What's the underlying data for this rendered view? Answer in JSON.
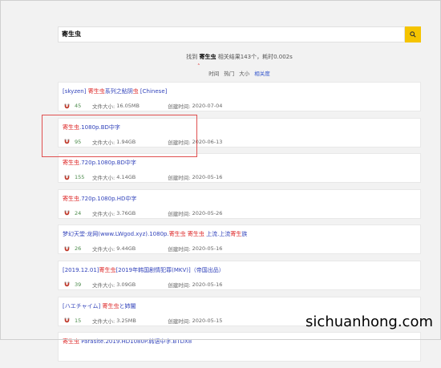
{
  "search": {
    "value": "寄生虫"
  },
  "summary": {
    "prefix": "找到",
    "keyword": "寄生虫",
    "suffix": "相关结果143个，耗时0.002s"
  },
  "sort": {
    "options": [
      "时间",
      "热门",
      "大小",
      "相关度"
    ],
    "active": "相关度"
  },
  "results": [
    {
      "title_parts": [
        {
          "t": "[skyzen] ",
          "hl": false
        },
        {
          "t": "寄生虫",
          "hl": true
        },
        {
          "t": "系列之鲇阴",
          "hl": false
        },
        {
          "t": "虫",
          "hl": true
        },
        {
          "t": " [Chinese]",
          "hl": false
        }
      ],
      "seeds": "45",
      "size_label": "文件大小:",
      "size": "16.05MB",
      "date_label": "创建时间:",
      "date": "2020-07-04"
    },
    {
      "title_parts": [
        {
          "t": "寄生虫",
          "hl": true
        },
        {
          "t": ".1080p.BD中字",
          "hl": false
        }
      ],
      "seeds": "95",
      "size_label": "文件大小:",
      "size": "1.94GB",
      "date_label": "创建时间:",
      "date": "2020-06-13"
    },
    {
      "title_parts": [
        {
          "t": "寄生虫",
          "hl": true
        },
        {
          "t": ".720p.1080p.BD中字",
          "hl": false
        }
      ],
      "seeds": "155",
      "size_label": "文件大小:",
      "size": "4.14GB",
      "date_label": "创建时间:",
      "date": "2020-05-16"
    },
    {
      "title_parts": [
        {
          "t": "寄生虫",
          "hl": true
        },
        {
          "t": ".720p.1080p.HD中字",
          "hl": false
        }
      ],
      "seeds": "24",
      "size_label": "文件大小:",
      "size": "3.76GB",
      "date_label": "创建时间:",
      "date": "2020-05-26"
    },
    {
      "title_parts": [
        {
          "t": "梦幻天堂·龙网(www.LWgod.xyz).1080p.",
          "hl": false
        },
        {
          "t": "寄生虫",
          "hl": true
        },
        {
          "t": " ",
          "hl": false
        },
        {
          "t": "寄生虫",
          "hl": true
        },
        {
          "t": " 上流.上流",
          "hl": false
        },
        {
          "t": "寄生",
          "hl": true
        },
        {
          "t": "族",
          "hl": false
        }
      ],
      "seeds": "26",
      "size_label": "文件大小:",
      "size": "9.44GB",
      "date_label": "创建时间:",
      "date": "2020-05-16"
    },
    {
      "title_parts": [
        {
          "t": "[2019.12.01]",
          "hl": false
        },
        {
          "t": "寄生虫",
          "hl": true
        },
        {
          "t": "[2019年韩国剧情犯罪(MKV)]（帝国出品）",
          "hl": false
        }
      ],
      "seeds": "39",
      "size_label": "文件大小:",
      "size": "3.09GB",
      "date_label": "创建时间:",
      "date": "2020-05-16"
    },
    {
      "title_parts": [
        {
          "t": "[ハエチャイム] ",
          "hl": false
        },
        {
          "t": "寄生虫",
          "hl": true
        },
        {
          "t": "と姉闇",
          "hl": false
        }
      ],
      "seeds": "15",
      "size_label": "文件大小:",
      "size": "3.25MB",
      "date_label": "创建时间:",
      "date": "2020-05-15"
    },
    {
      "title_parts": [
        {
          "t": "寄生虫",
          "hl": true
        },
        {
          "t": " Parasite.2019.HD1080P.韩语中字.BTDX8",
          "hl": false
        }
      ],
      "seeds": "",
      "size_label": "",
      "size": "",
      "date_label": "",
      "date": ""
    }
  ],
  "watermark": "sichuanhong.com",
  "colors": {
    "accent_button": "#f5c400",
    "highlight": "#d22222",
    "link": "#3344bb",
    "seed": "#4a8a4a",
    "annotation_box": "#e05050"
  }
}
